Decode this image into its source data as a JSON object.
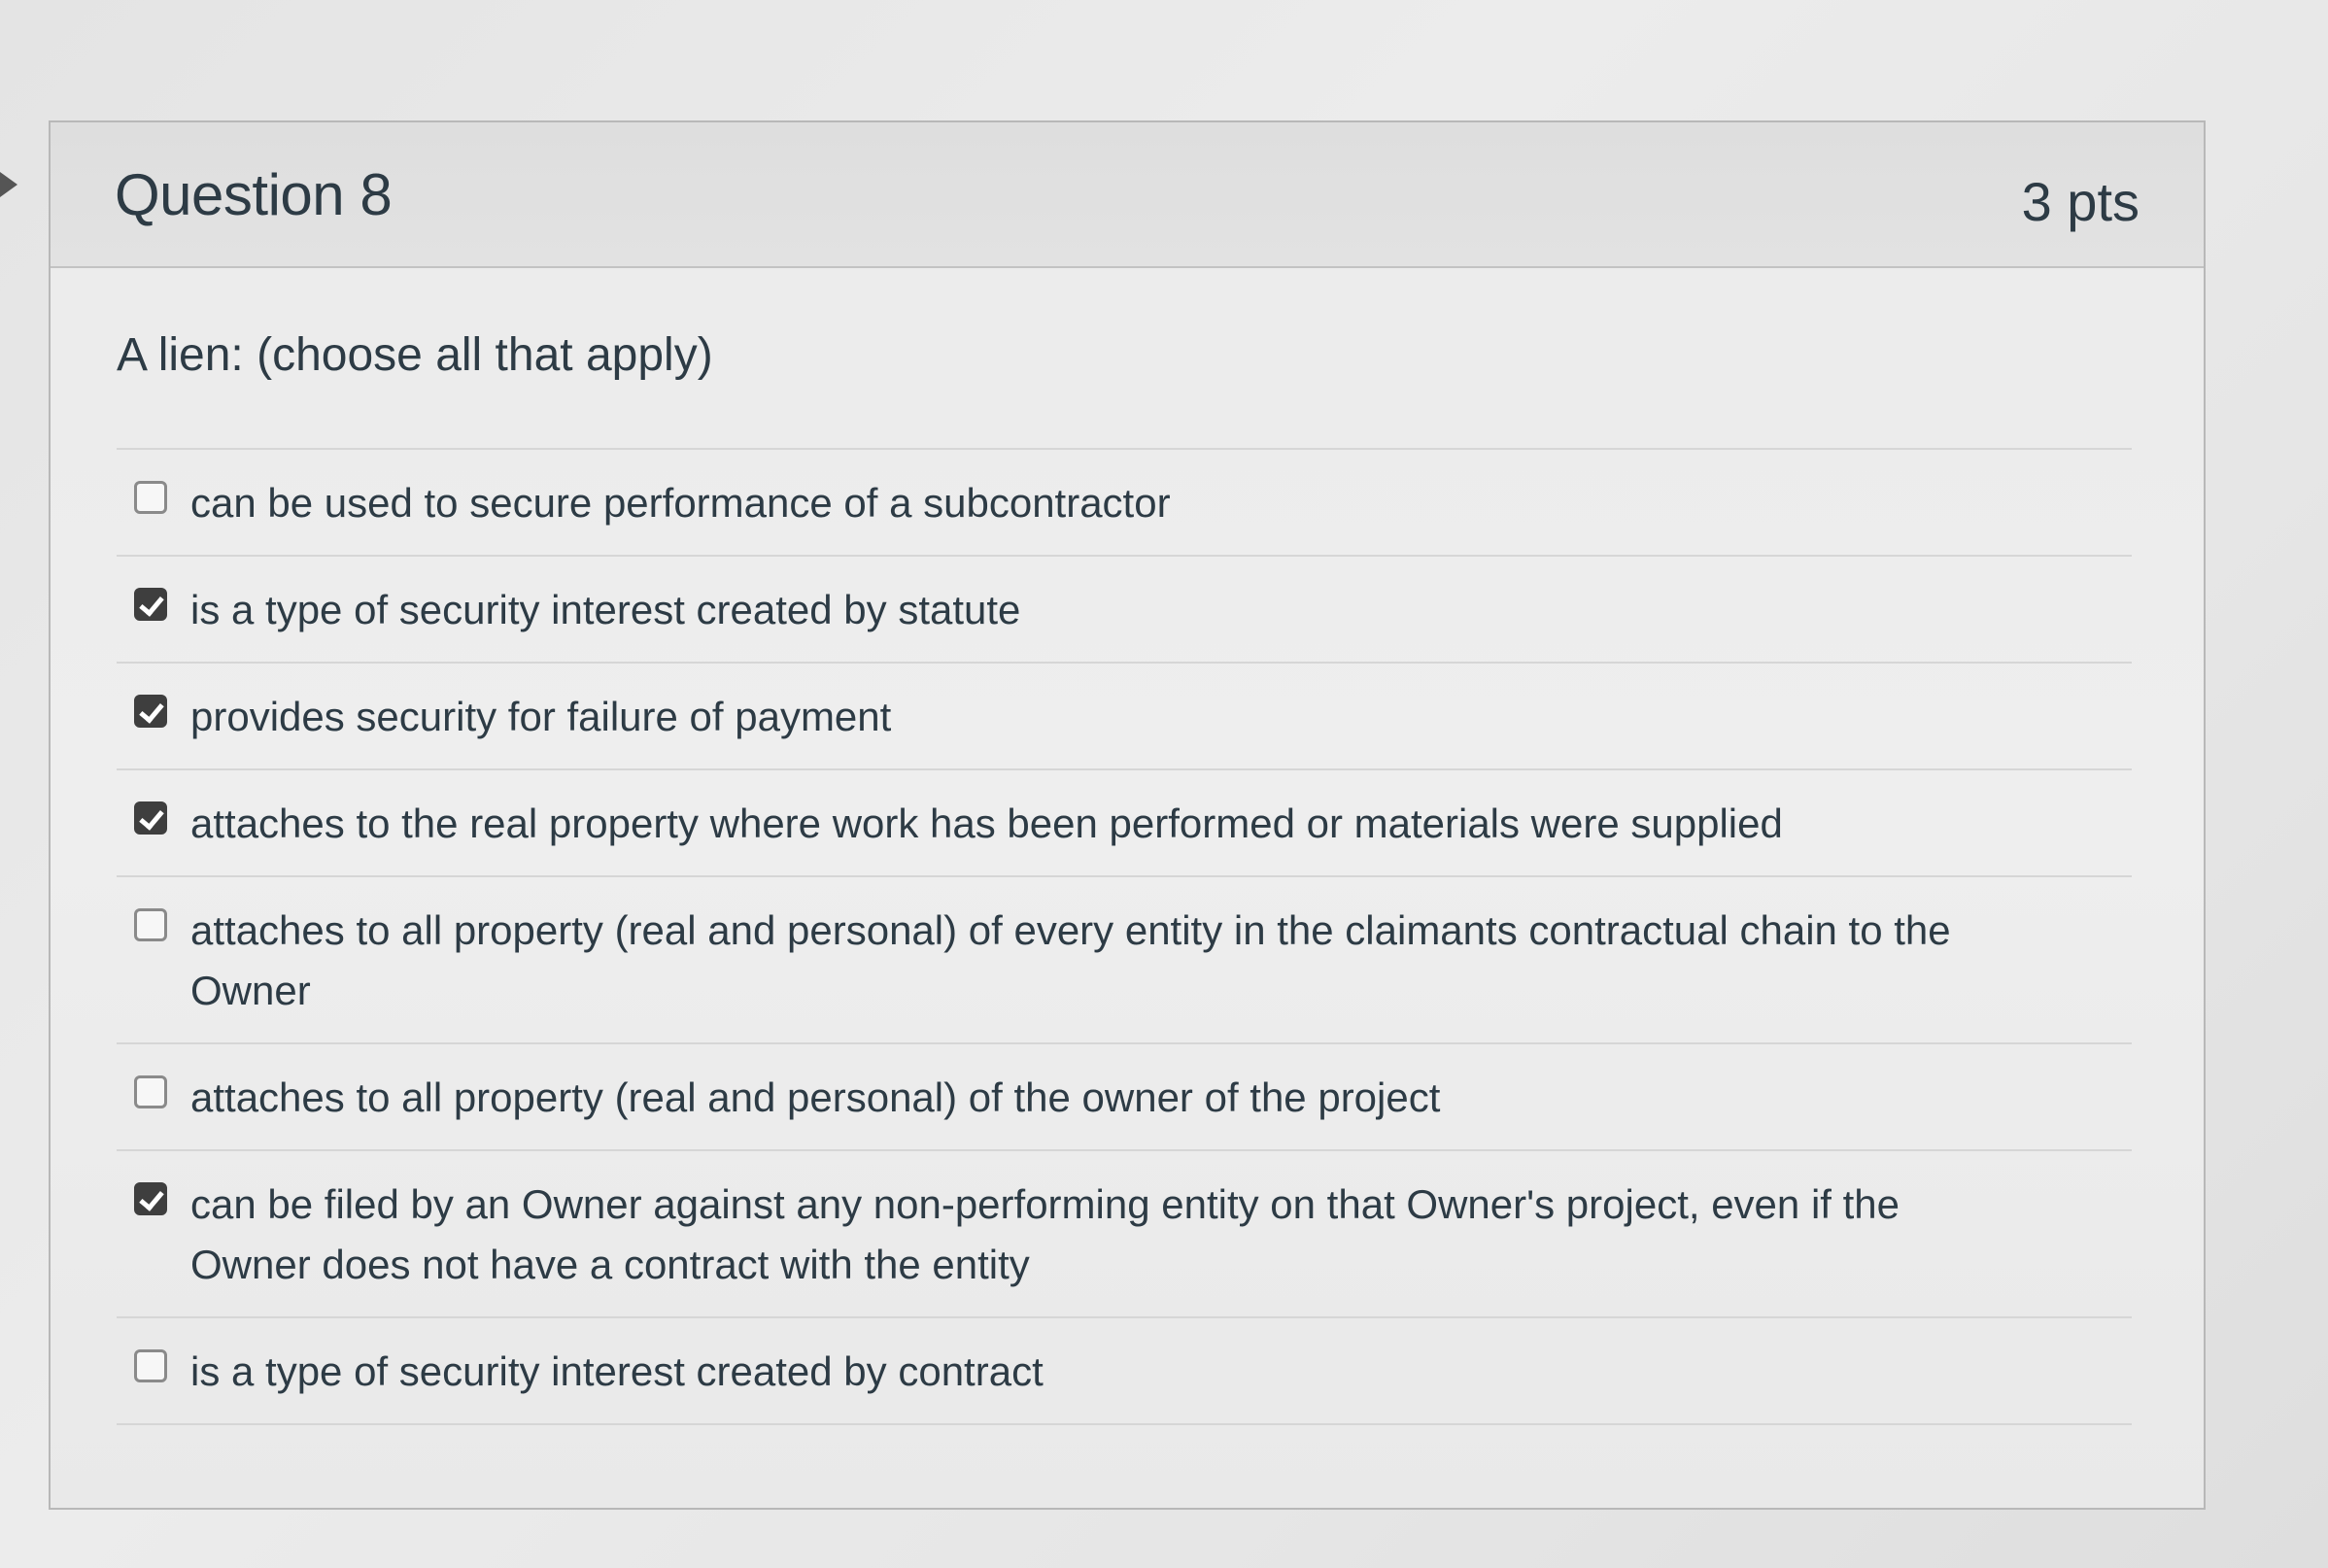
{
  "question": {
    "title": "Question 8",
    "points": "3 pts",
    "prompt": "A lien: (choose all that apply)",
    "answers": [
      {
        "label": "can be used to secure performance of a subcontractor",
        "checked": false
      },
      {
        "label": "is a type of security interest created by statute",
        "checked": true
      },
      {
        "label": "provides security for failure of payment",
        "checked": true
      },
      {
        "label": "attaches to the real property where work has been performed or materials were supplied",
        "checked": true
      },
      {
        "label": "attaches to all property (real and personal) of every entity in the claimants contractual chain to the Owner",
        "checked": false
      },
      {
        "label": "attaches to all property (real and personal) of the owner of the project",
        "checked": false
      },
      {
        "label": "can be filed by an Owner against any non-performing entity on that Owner's project, even if the Owner does not have a contract with the entity",
        "checked": true
      },
      {
        "label": "is a type of security interest created by contract",
        "checked": false
      }
    ]
  }
}
